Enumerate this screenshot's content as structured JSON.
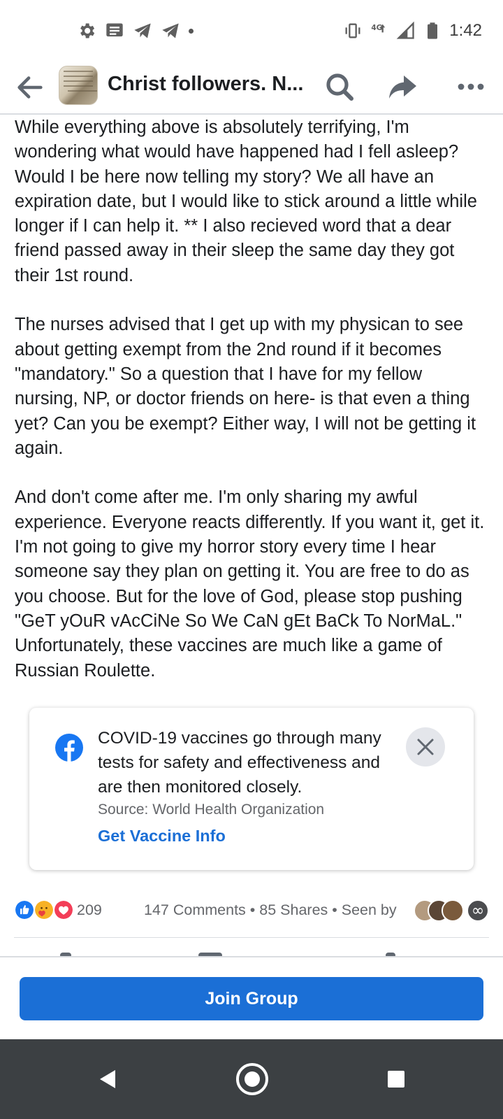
{
  "status_bar": {
    "time": "1:42",
    "left_icons": [
      "gear-icon",
      "message-icon",
      "telegram-icon",
      "telegram-icon",
      "dot-icon"
    ],
    "right_icons": [
      "vibrate-icon",
      "lte-signal-icon",
      "cell-signal-icon",
      "battery-icon"
    ]
  },
  "header": {
    "title": "Christ followers. N...",
    "actions": [
      "back-arrow-icon",
      "search-icon",
      "share-icon",
      "more-icon"
    ]
  },
  "post": {
    "paragraphs": [
      "While everything above is absolutely terrifying, I'm wondering what would have happened had I fell asleep? Would I be here now telling my story? We all have an expiration date, but I would like to stick around a little while longer if I can help it. ** I also recieved word that a dear friend passed away in their sleep the same day they got their 1st round.",
      "The nurses advised that I get up with my physican to see about getting exempt from the 2nd round if it becomes \"mandatory.\" So a question that I have for my fellow nursing, NP, or doctor friends on here- is that even a thing yet? Can you be exempt? Either way, I will not be getting it again.",
      "And don't come after me. I'm only sharing my awful experience. Everyone reacts differently. If you want it, get it. I'm not going to give my horror story every time I hear someone say they plan on getting it. You are free to do as you choose. But for the love of God, please stop pushing \"GeT yOuR vAcCiNe So We CaN gEt BaCk To NorMaL.\" Unfortunately, these vaccines are much like a game of Russian Roulette."
    ]
  },
  "info_card": {
    "text": "COVID-19 vaccines go through many tests for safety and effectiveness and are then monitored closely.",
    "source": "Source: World Health Organization",
    "link": "Get Vaccine Info",
    "colors": {
      "link": "#1b6fd6",
      "logo": "#1877f2"
    }
  },
  "engagement": {
    "reaction_icons": [
      "like-icon",
      "care-icon",
      "love-icon"
    ],
    "reaction_count": "209",
    "stats": "147 Comments • 85 Shares • Seen by",
    "seen_more": "∞"
  },
  "join_bar": {
    "button_label": "Join Group",
    "color": "#1b6fd6"
  },
  "nav_bar": {
    "buttons": [
      "nav-back-icon",
      "nav-home-icon",
      "nav-recent-icon"
    ]
  }
}
